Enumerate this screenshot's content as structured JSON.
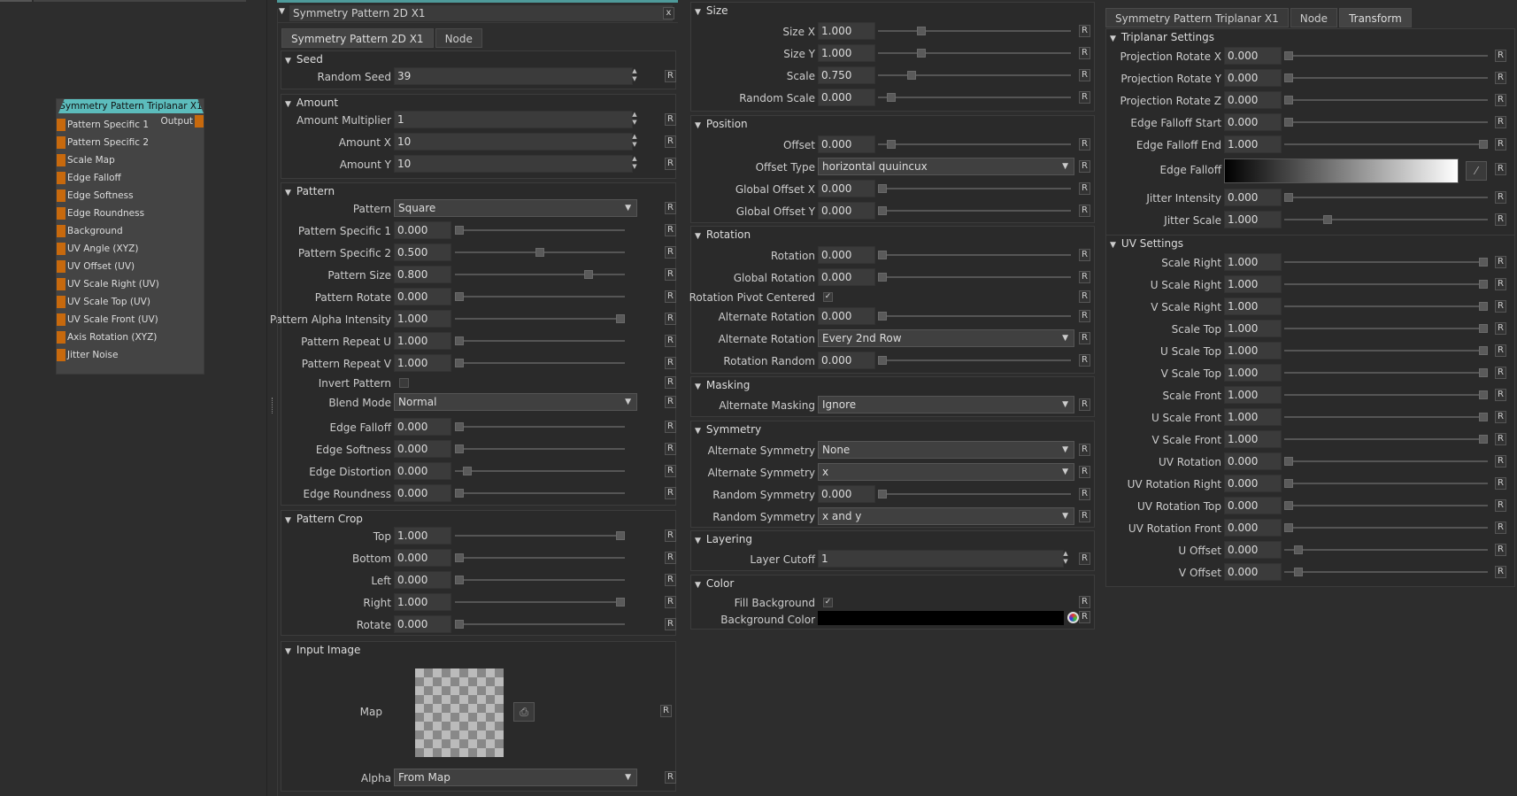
{
  "node": {
    "title": "Symmetry Pattern Triplanar X1",
    "output": "Output",
    "inputs": [
      "Pattern Specific 1",
      "Pattern Specific 2",
      "Scale Map",
      "Edge Falloff",
      "Edge Softness",
      "Edge Roundness",
      "Background",
      "UV Angle (XYZ)",
      "UV Offset (UV)",
      "UV Scale Right (UV)",
      "UV Scale Top (UV)",
      "UV Scale Front (UV)",
      "Axis Rotation (XYZ)",
      "Jitter Noise"
    ]
  },
  "p1": {
    "title": "Symmetry Pattern 2D X1",
    "close": "x",
    "tabs": [
      "Symmetry Pattern 2D X1",
      "Node"
    ],
    "reset": "R",
    "seed": {
      "head": "Seed",
      "random_seed_label": "Random Seed",
      "random_seed": "39"
    },
    "amount": {
      "head": "Amount",
      "mult_label": "Amount Multiplier",
      "mult": "1",
      "x_label": "Amount X",
      "x": "10",
      "y_label": "Amount Y",
      "y": "10"
    },
    "pattern": {
      "head": "Pattern",
      "pattern_label": "Pattern",
      "pattern": "Square",
      "rows": [
        {
          "label": "Pattern Specific 1",
          "value": "0.000",
          "level": 0
        },
        {
          "label": "Pattern Specific 2",
          "value": "0.500",
          "level": 0.5
        },
        {
          "label": "Pattern Size",
          "value": "0.800",
          "level": 0.8
        },
        {
          "label": "Pattern Rotate",
          "value": "0.000",
          "level": 0
        },
        {
          "label": "Pattern Alpha Intensity",
          "value": "1.000",
          "level": 1
        },
        {
          "label": "Pattern Repeat U",
          "value": "1.000",
          "level": 0
        },
        {
          "label": "Pattern Repeat V",
          "value": "1.000",
          "level": 0
        }
      ],
      "invert_label": "Invert Pattern",
      "blend_label": "Blend Mode",
      "blend": "Normal",
      "rows2": [
        {
          "label": "Edge Falloff",
          "value": "0.000",
          "level": 0
        },
        {
          "label": "Edge Softness",
          "value": "0.000",
          "level": 0
        },
        {
          "label": "Edge Distortion",
          "value": "0.000",
          "level": 0.05
        },
        {
          "label": "Edge Roundness",
          "value": "0.000",
          "level": 0
        }
      ]
    },
    "crop": {
      "head": "Pattern Crop",
      "rows": [
        {
          "label": "Top",
          "value": "1.000",
          "level": 1
        },
        {
          "label": "Bottom",
          "value": "0.000",
          "level": 0
        },
        {
          "label": "Left",
          "value": "0.000",
          "level": 0
        },
        {
          "label": "Right",
          "value": "1.000",
          "level": 1
        },
        {
          "label": "Rotate",
          "value": "0.000",
          "level": 0
        }
      ]
    },
    "input": {
      "head": "Input Image",
      "map_label": "Map",
      "alpha_label": "Alpha",
      "alpha": "From Map"
    }
  },
  "p2": {
    "reset": "R",
    "size": {
      "head": "Size",
      "rows": [
        {
          "label": "Size X",
          "value": "1.000",
          "level": 0.21
        },
        {
          "label": "Size Y",
          "value": "1.000",
          "level": 0.21
        },
        {
          "label": "Scale",
          "value": "0.750",
          "level": 0.16
        },
        {
          "label": "Random Scale",
          "value": "0.000",
          "level": 0.05
        }
      ]
    },
    "position": {
      "head": "Position",
      "offset_label": "Offset",
      "offset": "0.000",
      "offset_level": 0.05,
      "offset_type_label": "Offset Type",
      "offset_type": "horizontal quuincux",
      "rows": [
        {
          "label": "Global Offset X",
          "value": "0.000",
          "level": 0
        },
        {
          "label": "Global Offset Y",
          "value": "0.000",
          "level": 0
        }
      ]
    },
    "rotation": {
      "head": "Rotation",
      "rows": [
        {
          "label": "Rotation",
          "value": "0.000",
          "level": 0
        },
        {
          "label": "Global Rotation",
          "value": "0.000",
          "level": 0
        }
      ],
      "pivot_label": "Rotation Pivot Centered",
      "check": "✓",
      "alt_rot_label": "Alternate Rotation",
      "alt_rot": "0.000",
      "alt_rot2_label": "Alternate Rotation",
      "alt_rot2": "Every 2nd Row",
      "rot_random_label": "Rotation Random",
      "rot_random": "0.000"
    },
    "masking": {
      "head": "Masking",
      "label": "Alternate Masking",
      "value": "Ignore"
    },
    "symmetry": {
      "head": "Symmetry",
      "alt1_label": "Alternate Symmetry",
      "alt1": "None",
      "alt2_label": "Alternate Symmetry",
      "alt2": "x",
      "rand_label": "Random Symmetry",
      "rand": "0.000",
      "rand2_label": "Random Symmetry",
      "rand2": "x and y"
    },
    "layering": {
      "head": "Layering",
      "label": "Layer Cutoff",
      "value": "1"
    },
    "color": {
      "head": "Color",
      "fill_label": "Fill Background",
      "check": "✓",
      "bg_label": "Background Color",
      "bg_color": "#000000"
    }
  },
  "p3": {
    "tabs": [
      "Symmetry Pattern Triplanar X1",
      "Node",
      "Transform"
    ],
    "reset": "R",
    "triplanar": {
      "head": "Triplanar Settings",
      "rows": [
        {
          "label": "Projection Rotate X",
          "value": "0.000",
          "level": 0
        },
        {
          "label": "Projection Rotate Y",
          "value": "0.000",
          "level": 0
        },
        {
          "label": "Projection Rotate Z",
          "value": "0.000",
          "level": 0
        },
        {
          "label": "Edge Falloff Start",
          "value": "0.000",
          "level": 0
        },
        {
          "label": "Edge Falloff End",
          "value": "1.000",
          "level": 1
        }
      ],
      "falloff_label": "Edge Falloff",
      "rows2": [
        {
          "label": "Jitter Intensity",
          "value": "0.000",
          "level": 0
        },
        {
          "label": "Jitter Scale",
          "value": "1.000",
          "level": 0.2
        }
      ]
    },
    "uv": {
      "head": "UV Settings",
      "rows": [
        {
          "label": "Scale Right",
          "value": "1.000",
          "level": 1
        },
        {
          "label": "U Scale Right",
          "value": "1.000",
          "level": 1
        },
        {
          "label": "V Scale Right",
          "value": "1.000",
          "level": 1
        },
        {
          "label": "Scale Top",
          "value": "1.000",
          "level": 1
        },
        {
          "label": "U Scale Top",
          "value": "1.000",
          "level": 1
        },
        {
          "label": "V Scale Top",
          "value": "1.000",
          "level": 1
        },
        {
          "label": "Scale Front",
          "value": "1.000",
          "level": 1
        },
        {
          "label": "U Scale Front",
          "value": "1.000",
          "level": 1
        },
        {
          "label": "V Scale Front",
          "value": "1.000",
          "level": 1
        },
        {
          "label": "UV Rotation",
          "value": "0.000",
          "level": 0
        },
        {
          "label": "UV Rotation Right",
          "value": "0.000",
          "level": 0
        },
        {
          "label": "UV Rotation Top",
          "value": "0.000",
          "level": 0
        },
        {
          "label": "UV Rotation Front",
          "value": "0.000",
          "level": 0
        },
        {
          "label": "U Offset",
          "value": "0.000",
          "level": 0.05
        },
        {
          "label": "V Offset",
          "value": "0.000",
          "level": 0.05
        }
      ]
    }
  }
}
